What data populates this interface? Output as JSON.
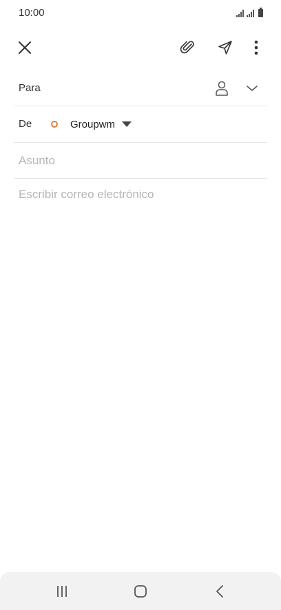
{
  "status_bar": {
    "time": "10:00",
    "icons": [
      "signal-icon",
      "signal-icon",
      "battery-icon"
    ]
  },
  "toolbar": {
    "close_icon": "close-icon",
    "attach_icon": "paperclip-icon",
    "send_icon": "send-icon",
    "more_icon": "more-vertical-icon"
  },
  "compose": {
    "to_label": "Para",
    "to_value": "",
    "from_label": "De",
    "from_value": "Groupwm",
    "account_color": "#e47a45",
    "subject_placeholder": "Asunto",
    "subject_value": "",
    "body_placeholder": "Escribir correo electrónico",
    "body_value": ""
  },
  "nav_bar": {
    "recents_icon": "recents-icon",
    "home_icon": "home-icon",
    "back_icon": "back-icon"
  }
}
